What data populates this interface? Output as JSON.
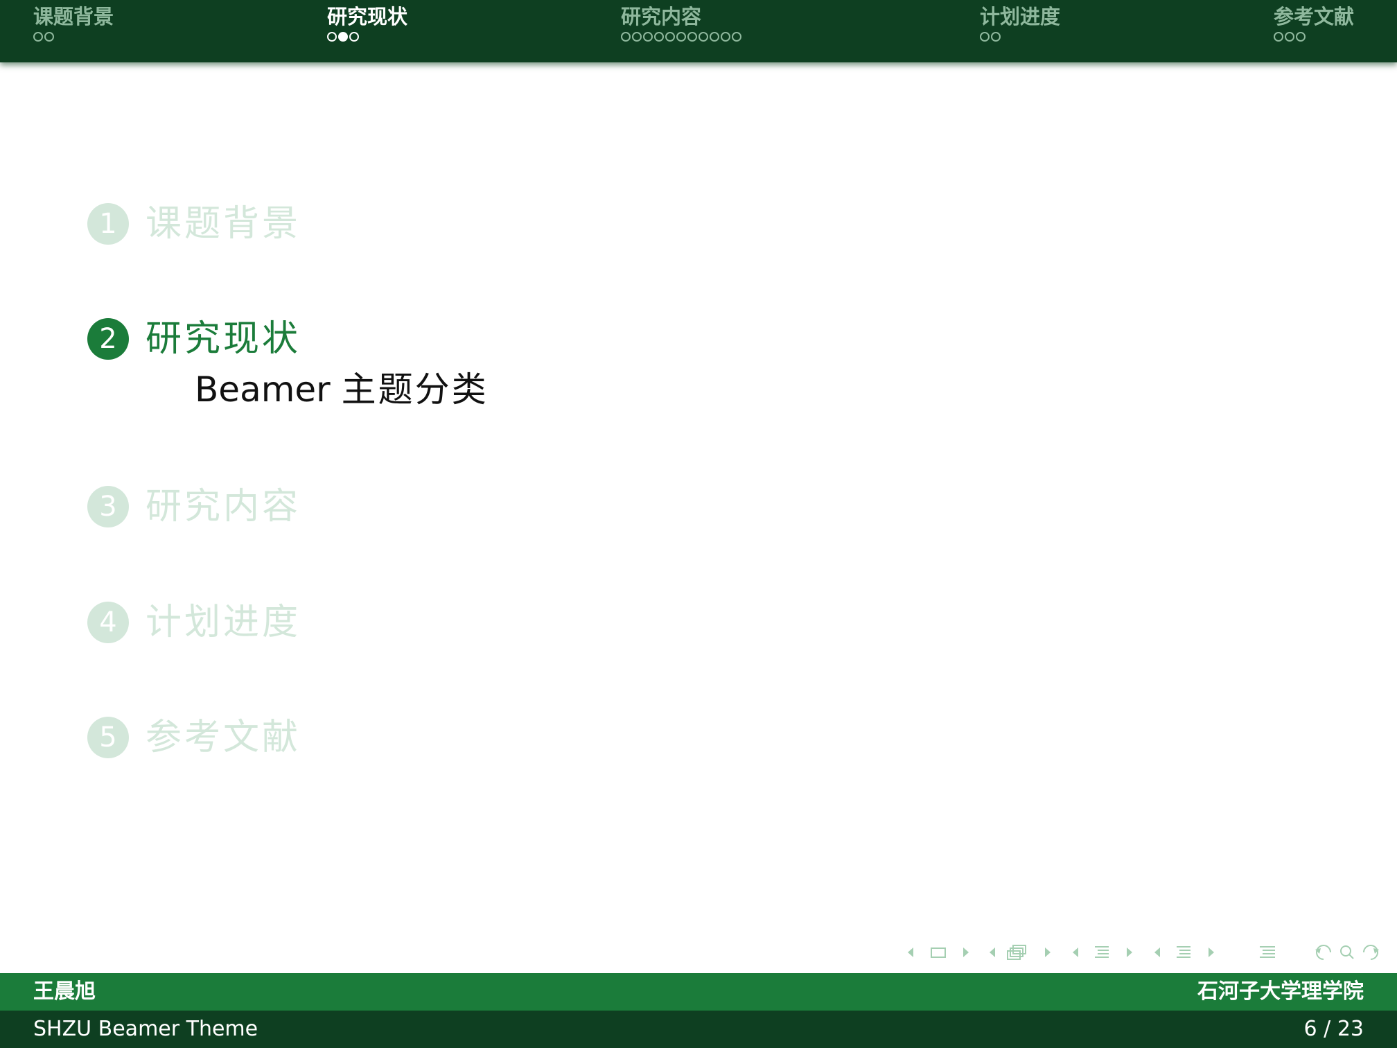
{
  "header": {
    "sections": [
      {
        "title": "课题背景",
        "frames": 2,
        "current": -1
      },
      {
        "title": "研究现状",
        "frames": 3,
        "current": 1
      },
      {
        "title": "研究内容",
        "frames": 11,
        "current": -1
      },
      {
        "title": "计划进度",
        "frames": 2,
        "current": -1
      },
      {
        "title": "参考文献",
        "frames": 3,
        "current": -1
      }
    ],
    "active_index": 1
  },
  "toc": {
    "items": [
      {
        "number": "1",
        "title": "课题背景"
      },
      {
        "number": "2",
        "title": "研究现状"
      },
      {
        "number": "3",
        "title": "研究内容"
      },
      {
        "number": "4",
        "title": "计划进度"
      },
      {
        "number": "5",
        "title": "参考文献"
      }
    ],
    "active_subsection": {
      "latin": "Beamer",
      "zh": "主题分类"
    }
  },
  "footer": {
    "author": "王晨旭",
    "institute": "石河子大学理学院",
    "title": "SHZU Beamer Theme",
    "page": "6 / 23"
  },
  "colors": {
    "header_bg": "#0e3f21",
    "footer_top": "#1b7c3a",
    "footer_bottom": "#0e3f21",
    "active": "#1b7c3a",
    "inactive": "#d3e7da"
  },
  "nav_icons": [
    "prev-frame-icon",
    "frame-icon",
    "next-frame-icon",
    "prev-subsection-icon",
    "subsection-icon",
    "next-subsection-icon",
    "prev-section-icon",
    "section-icon",
    "next-section-icon",
    "document-icon",
    "undo-icon",
    "search-icon",
    "redo-icon"
  ]
}
